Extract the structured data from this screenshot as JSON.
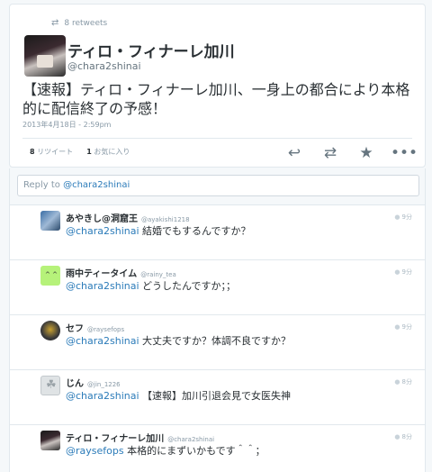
{
  "tweet": {
    "retweet_icon": "retweet-icon",
    "retweet_count_label": "8 retweets",
    "author_name": "ティロ・フィナーレ加川",
    "author_handle": "@chara2shinai",
    "text": "【速報】ティロ・フィナーレ加川、一身上の都合により本格的に配信終了の予感！",
    "timestamp": "2013年4月18日 - 2:59pm",
    "stats": {
      "retweets_num": "8",
      "retweets_label": "リツイート",
      "favorites_num": "1",
      "favorites_label": "お気に入り"
    },
    "actions": [
      "reply-icon",
      "retweet-icon",
      "favorite-star-icon",
      "more-dots-icon"
    ]
  },
  "reply_box": {
    "prefix": "Reply to ",
    "mention": "@chara2shinai"
  },
  "replies": [
    {
      "name": "あやきし@洞窟王",
      "handle": "@ayakishi1218",
      "mention": "@chara2shinai",
      "text": " 結婚でもするんですか？",
      "ago": "9分"
    },
    {
      "name": "雨中ティータイム",
      "handle": "@rainy_tea",
      "mention": "@chara2shinai",
      "text": " どうしたんですか；；",
      "ago": "9分"
    },
    {
      "name": "セフ",
      "handle": "@raysefops",
      "mention": "@chara2shinai",
      "text": " 大丈夫ですか？体調不良ですか？",
      "ago": "9分"
    },
    {
      "name": "じん",
      "handle": "@jin_1226",
      "mention": "@chara2shinai",
      "text": " 【速報】加川引退会見で女医失神",
      "ago": "8分"
    },
    {
      "name": "ティロ・フィナーレ加川",
      "handle": "@chara2shinai",
      "mention": "@raysefops",
      "text": " 本格的にまずいかもです＾＾；",
      "ago": "8分"
    }
  ],
  "colors": {
    "link_blue": "#2b7bb9",
    "muted_gray": "#8899a6",
    "text_dark": "#292f33",
    "border": "#e1e8ed"
  }
}
